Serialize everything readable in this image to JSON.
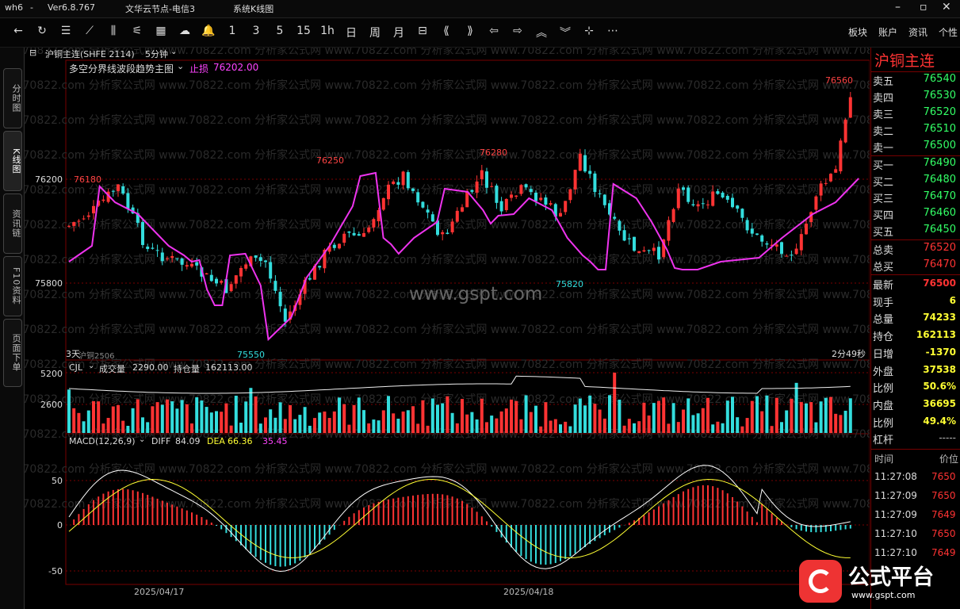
{
  "titlebar": {
    "app": "wh6",
    "sep": "-",
    "version": "Ver6.8.767",
    "server": "文华云节点-电信3",
    "menu": "系统K线图"
  },
  "toolbar": {
    "periods": [
      "1",
      "3",
      "5",
      "15",
      "1h",
      "日",
      "周",
      "月"
    ],
    "right": [
      "板块",
      "账户",
      "资讯",
      "个性"
    ]
  },
  "leftnav": [
    "分时图",
    "K线图",
    "资讯链",
    "F10资料",
    "页面下单"
  ],
  "header": {
    "contract": "沪铜主连(SHFE 2114)",
    "period": "5分钟"
  },
  "main_indicator": {
    "name": "多空分界线波段趋势主图",
    "stop_label": "止损",
    "stop_value": "76202.00"
  },
  "price_labels": {
    "p76560": "76560",
    "p76250": "76250",
    "p76280": "76280",
    "p76180": "76180",
    "p75820": "75820",
    "p75550": "75550"
  },
  "yaxis_main": [
    "76200",
    "75800"
  ],
  "bottom_left": "3天",
  "bottom_left2": "沪铜2506",
  "countdown": "2分49秒",
  "watermark": "www.gspt.com",
  "watermark_bg": "www.70822.com 分析家公式网",
  "vol_panel": {
    "name": "CJL",
    "vol_label": "成交量",
    "vol_value": "2290.00",
    "oi_label": "持仓量",
    "oi_value": "162113.00",
    "ticks": [
      "5200",
      "2600"
    ]
  },
  "macd_panel": {
    "name": "MACD(12,26,9)",
    "diff_label": "DIFF",
    "diff_value": "84.09",
    "dea_label": "DEA",
    "dea_value": "66.36",
    "macd_value": "35.45",
    "ticks": [
      "50",
      "0",
      "-50"
    ]
  },
  "xaxis": [
    "2025/04/17",
    "2025/04/18"
  ],
  "quote": {
    "name": "沪铜主连",
    "asks": [
      {
        "label": "卖五",
        "price": "76540"
      },
      {
        "label": "卖四",
        "price": "76530"
      },
      {
        "label": "卖三",
        "price": "76520"
      },
      {
        "label": "卖二",
        "price": "76510"
      },
      {
        "label": "卖一",
        "price": "76500"
      }
    ],
    "bids": [
      {
        "label": "买一",
        "price": "76490"
      },
      {
        "label": "买二",
        "price": "76480"
      },
      {
        "label": "买三",
        "price": "76470"
      },
      {
        "label": "买四",
        "price": "76460"
      },
      {
        "label": "买五",
        "price": "76450"
      }
    ],
    "total_sell_label": "总卖",
    "total_sell": "76520",
    "total_buy_label": "总买",
    "total_buy": "76470",
    "stats": [
      {
        "label": "最新",
        "value": "76500"
      },
      {
        "label": "现手",
        "value": "6"
      },
      {
        "label": "总量",
        "value": "74233"
      },
      {
        "label": "持仓",
        "value": "162113"
      },
      {
        "label": "日增",
        "value": "-1370"
      },
      {
        "label": "外盘",
        "value": "37538"
      },
      {
        "label": "比例",
        "value": "50.6%"
      },
      {
        "label": "内盘",
        "value": "36695"
      },
      {
        "label": "比例",
        "value": "49.4%"
      },
      {
        "label": "杠杆",
        "value": "-----"
      }
    ],
    "ticks_header": {
      "time": "时间",
      "price": "价位"
    },
    "ticks": [
      {
        "time": "11:27:08",
        "price": "7650"
      },
      {
        "time": "11:27:09",
        "price": "7650"
      },
      {
        "time": "11:27:09",
        "price": "7649"
      },
      {
        "time": "11:27:10",
        "price": "7650"
      },
      {
        "time": "11:27:10",
        "price": "7649"
      }
    ]
  },
  "logo": {
    "text": "公式平台",
    "url": "www.gspt.com"
  }
}
